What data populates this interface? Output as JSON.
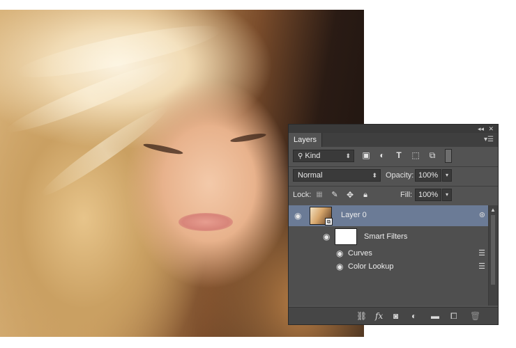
{
  "canvas": {
    "image_description": "photo"
  },
  "layers_panel": {
    "title": "Layers",
    "filter": {
      "label": "Kind"
    },
    "blend_mode": "Normal",
    "opacity_label": "Opacity:",
    "opacity_value": "100%",
    "lock_label": "Lock:",
    "fill_label": "Fill:",
    "fill_value": "100%",
    "layers": [
      {
        "name": "Layer 0",
        "selected": true
      },
      {
        "name": "Smart Filters"
      },
      {
        "name": "Curves"
      },
      {
        "name": "Color Lookup"
      }
    ],
    "colors": {
      "panel_bg": "#535353",
      "selected_row": "#6b7b96"
    }
  }
}
